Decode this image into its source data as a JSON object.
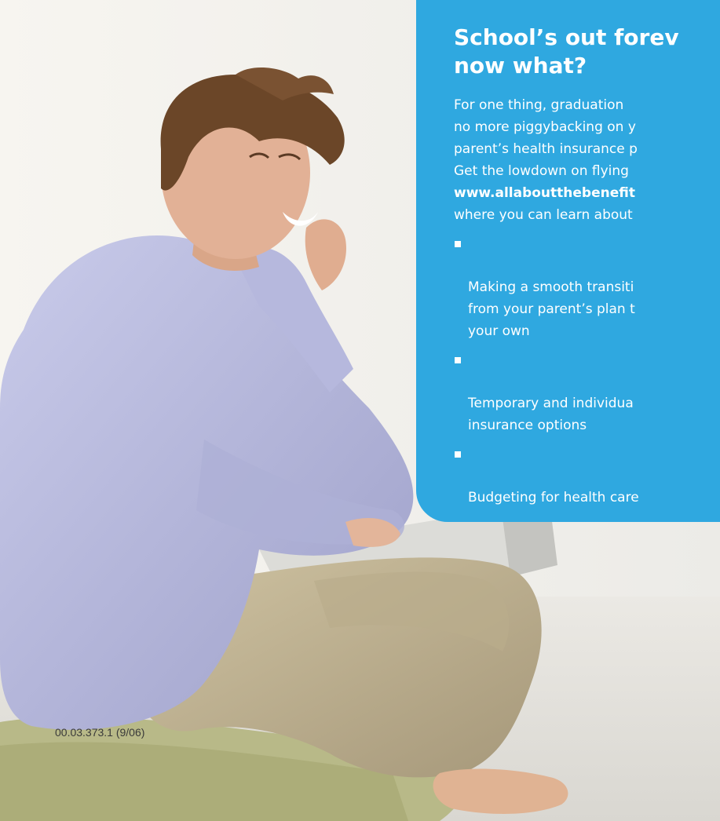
{
  "headline": "School’s out forev\nnow what?",
  "intro_lines": [
    "For one thing, graduation",
    "no more piggybacking on y",
    "parent’s health insurance p",
    "Get the lowdown on flying",
    "www.allaboutthebenefit",
    "where you can learn about"
  ],
  "bullets": [
    "Making a smooth transiti\nfrom your parent’s plan t\nyour own",
    "Temporary and individua\ninsurance options",
    "Budgeting for health care"
  ],
  "form_code": "00.03.373.1  (9/06)",
  "colors": {
    "panel": "#2fa8e0",
    "text_on_panel": "#ffffff"
  }
}
